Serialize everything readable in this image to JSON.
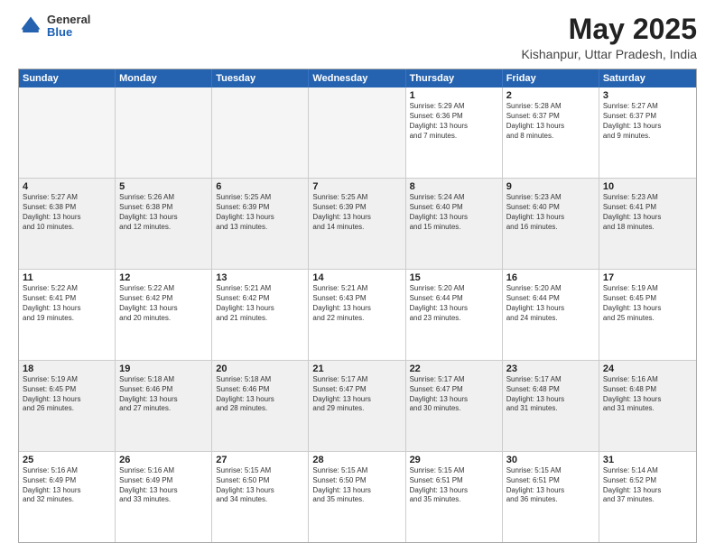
{
  "header": {
    "logo_general": "General",
    "logo_blue": "Blue",
    "title": "May 2025",
    "subtitle": "Kishanpur, Uttar Pradesh, India"
  },
  "weekdays": [
    "Sunday",
    "Monday",
    "Tuesday",
    "Wednesday",
    "Thursday",
    "Friday",
    "Saturday"
  ],
  "weeks": [
    [
      {
        "day": "",
        "info": ""
      },
      {
        "day": "",
        "info": ""
      },
      {
        "day": "",
        "info": ""
      },
      {
        "day": "",
        "info": ""
      },
      {
        "day": "1",
        "info": "Sunrise: 5:29 AM\nSunset: 6:36 PM\nDaylight: 13 hours\nand 7 minutes."
      },
      {
        "day": "2",
        "info": "Sunrise: 5:28 AM\nSunset: 6:37 PM\nDaylight: 13 hours\nand 8 minutes."
      },
      {
        "day": "3",
        "info": "Sunrise: 5:27 AM\nSunset: 6:37 PM\nDaylight: 13 hours\nand 9 minutes."
      }
    ],
    [
      {
        "day": "4",
        "info": "Sunrise: 5:27 AM\nSunset: 6:38 PM\nDaylight: 13 hours\nand 10 minutes."
      },
      {
        "day": "5",
        "info": "Sunrise: 5:26 AM\nSunset: 6:38 PM\nDaylight: 13 hours\nand 12 minutes."
      },
      {
        "day": "6",
        "info": "Sunrise: 5:25 AM\nSunset: 6:39 PM\nDaylight: 13 hours\nand 13 minutes."
      },
      {
        "day": "7",
        "info": "Sunrise: 5:25 AM\nSunset: 6:39 PM\nDaylight: 13 hours\nand 14 minutes."
      },
      {
        "day": "8",
        "info": "Sunrise: 5:24 AM\nSunset: 6:40 PM\nDaylight: 13 hours\nand 15 minutes."
      },
      {
        "day": "9",
        "info": "Sunrise: 5:23 AM\nSunset: 6:40 PM\nDaylight: 13 hours\nand 16 minutes."
      },
      {
        "day": "10",
        "info": "Sunrise: 5:23 AM\nSunset: 6:41 PM\nDaylight: 13 hours\nand 18 minutes."
      }
    ],
    [
      {
        "day": "11",
        "info": "Sunrise: 5:22 AM\nSunset: 6:41 PM\nDaylight: 13 hours\nand 19 minutes."
      },
      {
        "day": "12",
        "info": "Sunrise: 5:22 AM\nSunset: 6:42 PM\nDaylight: 13 hours\nand 20 minutes."
      },
      {
        "day": "13",
        "info": "Sunrise: 5:21 AM\nSunset: 6:42 PM\nDaylight: 13 hours\nand 21 minutes."
      },
      {
        "day": "14",
        "info": "Sunrise: 5:21 AM\nSunset: 6:43 PM\nDaylight: 13 hours\nand 22 minutes."
      },
      {
        "day": "15",
        "info": "Sunrise: 5:20 AM\nSunset: 6:44 PM\nDaylight: 13 hours\nand 23 minutes."
      },
      {
        "day": "16",
        "info": "Sunrise: 5:20 AM\nSunset: 6:44 PM\nDaylight: 13 hours\nand 24 minutes."
      },
      {
        "day": "17",
        "info": "Sunrise: 5:19 AM\nSunset: 6:45 PM\nDaylight: 13 hours\nand 25 minutes."
      }
    ],
    [
      {
        "day": "18",
        "info": "Sunrise: 5:19 AM\nSunset: 6:45 PM\nDaylight: 13 hours\nand 26 minutes."
      },
      {
        "day": "19",
        "info": "Sunrise: 5:18 AM\nSunset: 6:46 PM\nDaylight: 13 hours\nand 27 minutes."
      },
      {
        "day": "20",
        "info": "Sunrise: 5:18 AM\nSunset: 6:46 PM\nDaylight: 13 hours\nand 28 minutes."
      },
      {
        "day": "21",
        "info": "Sunrise: 5:17 AM\nSunset: 6:47 PM\nDaylight: 13 hours\nand 29 minutes."
      },
      {
        "day": "22",
        "info": "Sunrise: 5:17 AM\nSunset: 6:47 PM\nDaylight: 13 hours\nand 30 minutes."
      },
      {
        "day": "23",
        "info": "Sunrise: 5:17 AM\nSunset: 6:48 PM\nDaylight: 13 hours\nand 31 minutes."
      },
      {
        "day": "24",
        "info": "Sunrise: 5:16 AM\nSunset: 6:48 PM\nDaylight: 13 hours\nand 31 minutes."
      }
    ],
    [
      {
        "day": "25",
        "info": "Sunrise: 5:16 AM\nSunset: 6:49 PM\nDaylight: 13 hours\nand 32 minutes."
      },
      {
        "day": "26",
        "info": "Sunrise: 5:16 AM\nSunset: 6:49 PM\nDaylight: 13 hours\nand 33 minutes."
      },
      {
        "day": "27",
        "info": "Sunrise: 5:15 AM\nSunset: 6:50 PM\nDaylight: 13 hours\nand 34 minutes."
      },
      {
        "day": "28",
        "info": "Sunrise: 5:15 AM\nSunset: 6:50 PM\nDaylight: 13 hours\nand 35 minutes."
      },
      {
        "day": "29",
        "info": "Sunrise: 5:15 AM\nSunset: 6:51 PM\nDaylight: 13 hours\nand 35 minutes."
      },
      {
        "day": "30",
        "info": "Sunrise: 5:15 AM\nSunset: 6:51 PM\nDaylight: 13 hours\nand 36 minutes."
      },
      {
        "day": "31",
        "info": "Sunrise: 5:14 AM\nSunset: 6:52 PM\nDaylight: 13 hours\nand 37 minutes."
      }
    ]
  ]
}
